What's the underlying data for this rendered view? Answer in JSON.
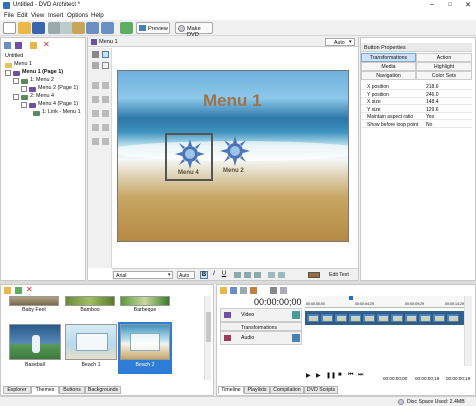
{
  "window": {
    "title": "Untitled - DVD Architect *"
  },
  "menubar": [
    "File",
    "Edit",
    "View",
    "Insert",
    "Options",
    "Help"
  ],
  "toolbar": {
    "preview_label": "Preview",
    "make_dvd_label": "Make DVD"
  },
  "tree": {
    "root": "Untitled",
    "items": [
      "Menu 1",
      "Menu 1 (Page 1)",
      "1: Menu 2",
      "Menu 2 (Page 1)",
      "2: Menu 4",
      "Menu 4 (Page 1)",
      "1: Link - Menu 1"
    ]
  },
  "editor": {
    "tab_label": "Menu 1",
    "zoom": "Auto",
    "menu_title": "Menu 1",
    "buttons": [
      "Menu 4",
      "Menu 2"
    ],
    "font": "Arial",
    "size": "Auto",
    "edit_text_label": "Edit Text"
  },
  "properties": {
    "header": "Button Properties",
    "tabs": [
      "Transformations",
      "Action",
      "Media",
      "Highlight",
      "Navigation",
      "Color Sets"
    ],
    "rows": [
      {
        "k": "X position",
        "v": "218.6"
      },
      {
        "k": "Y position",
        "v": "246.0"
      },
      {
        "k": "X size",
        "v": "148.4"
      },
      {
        "k": "Y size",
        "v": "129.6"
      },
      {
        "k": "Maintain aspect ratio",
        "v": "Yes"
      },
      {
        "k": "Show before loop point",
        "v": "No"
      }
    ]
  },
  "themes": {
    "items": [
      "Baby Feet",
      "Bamboo",
      "Barbeque",
      "Baseball",
      "Beach 1",
      "Beach 2"
    ],
    "tabs": [
      "Explorer",
      "Themes",
      "Buttons",
      "Backgrounds"
    ]
  },
  "timeline": {
    "time": "00:00:00;00",
    "ruler": [
      "00:00:00;00",
      "00:00:04;29",
      "00:00:09;29",
      "00:00:14;29"
    ],
    "tracks": [
      "Video",
      "Transformations",
      "Audio"
    ],
    "tabs": [
      "Timeline",
      "Playlists",
      "Compilation",
      "DVD Scripts"
    ],
    "end_time_left": "00:00:00;00",
    "end_time_mid": "00:00:00;19",
    "end_time_right": "00:00:00;19"
  },
  "status": {
    "disc_space": "Disc Space Used: 2.4MB"
  }
}
